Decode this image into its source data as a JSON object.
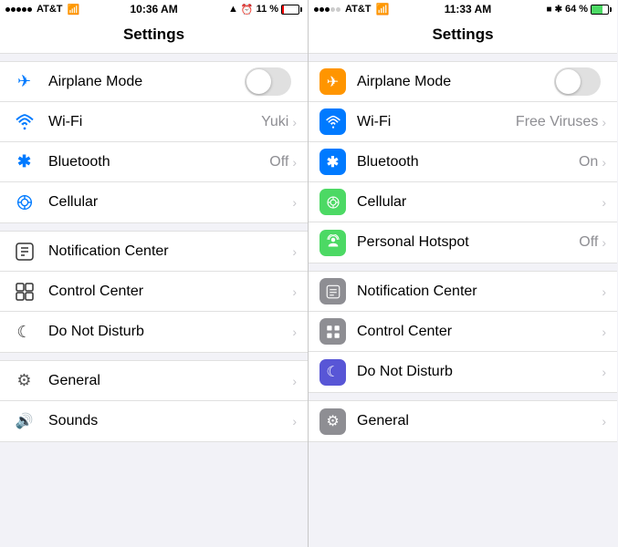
{
  "left_phone": {
    "status_bar": {
      "carrier": "AT&T",
      "time": "10:36 AM",
      "battery_percent": 11,
      "battery_low": true
    },
    "title": "Settings",
    "sections": [
      {
        "id": "connectivity",
        "items": [
          {
            "id": "airplane-mode",
            "label": "Airplane Mode",
            "icon_bg": "none",
            "icon_unicode": "✈",
            "icon_color": "#007aff",
            "type": "toggle",
            "value": false
          },
          {
            "id": "wifi",
            "label": "Wi-Fi",
            "icon_bg": "none",
            "icon_unicode": "📶",
            "type": "chevron",
            "value": "Yuki"
          },
          {
            "id": "bluetooth",
            "label": "Bluetooth",
            "icon_bg": "none",
            "icon_unicode": "✱",
            "type": "chevron",
            "value": "Off"
          },
          {
            "id": "cellular",
            "label": "Cellular",
            "icon_bg": "none",
            "icon_unicode": "📡",
            "type": "chevron",
            "value": ""
          }
        ]
      },
      {
        "id": "notifications",
        "items": [
          {
            "id": "notification-center",
            "label": "Notification Center",
            "type": "chevron",
            "value": ""
          },
          {
            "id": "control-center",
            "label": "Control Center",
            "type": "chevron",
            "value": ""
          },
          {
            "id": "do-not-disturb",
            "label": "Do Not Disturb",
            "type": "chevron",
            "value": ""
          }
        ]
      },
      {
        "id": "system",
        "items": [
          {
            "id": "general",
            "label": "General",
            "type": "chevron",
            "value": ""
          },
          {
            "id": "sounds",
            "label": "Sounds",
            "type": "chevron",
            "value": ""
          }
        ]
      }
    ]
  },
  "right_phone": {
    "status_bar": {
      "carrier": "AT&T",
      "time": "11:33 AM",
      "battery_percent": 64,
      "battery_low": false
    },
    "title": "Settings",
    "sections": [
      {
        "id": "connectivity",
        "items": [
          {
            "id": "airplane-mode",
            "label": "Airplane Mode",
            "icon_bg": "orange",
            "type": "toggle",
            "value": false
          },
          {
            "id": "wifi",
            "label": "Wi-Fi",
            "icon_bg": "blue",
            "type": "chevron",
            "value": "Free Viruses"
          },
          {
            "id": "bluetooth",
            "label": "Bluetooth",
            "icon_bg": "blue",
            "type": "chevron",
            "value": "On"
          },
          {
            "id": "cellular",
            "label": "Cellular",
            "icon_bg": "green",
            "type": "chevron",
            "value": ""
          },
          {
            "id": "personal-hotspot",
            "label": "Personal Hotspot",
            "icon_bg": "green",
            "type": "chevron",
            "value": "Off"
          }
        ]
      },
      {
        "id": "notifications",
        "items": [
          {
            "id": "notification-center",
            "label": "Notification Center",
            "icon_bg": "gray",
            "type": "chevron",
            "value": ""
          },
          {
            "id": "control-center",
            "label": "Control Center",
            "icon_bg": "gray",
            "type": "chevron",
            "value": ""
          },
          {
            "id": "do-not-disturb",
            "label": "Do Not Disturb",
            "icon_bg": "purple",
            "type": "chevron",
            "value": ""
          }
        ]
      },
      {
        "id": "system",
        "items": [
          {
            "id": "general",
            "label": "General",
            "icon_bg": "gray",
            "type": "chevron",
            "value": ""
          }
        ]
      }
    ]
  }
}
